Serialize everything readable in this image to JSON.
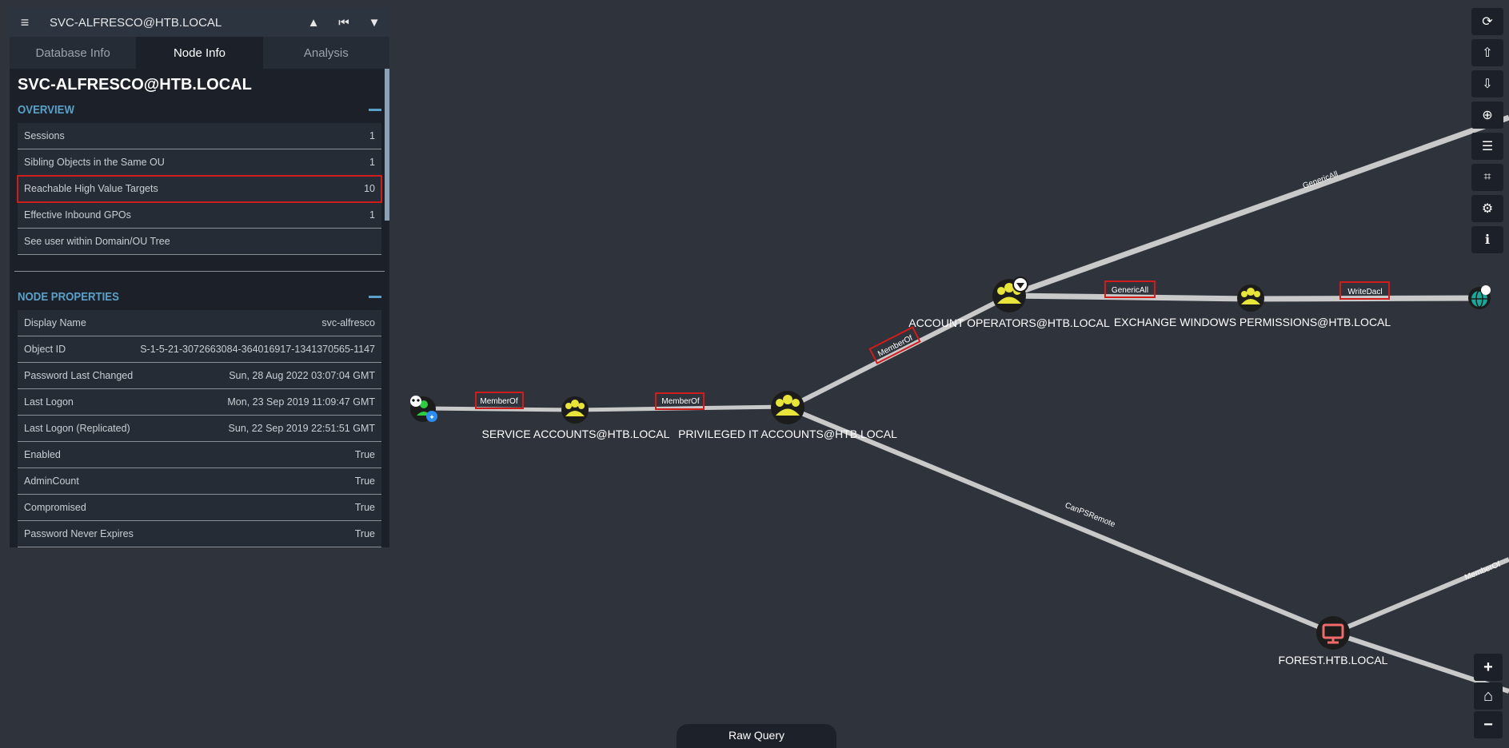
{
  "search": {
    "title": "SVC-ALFRESCO@HTB.LOCAL"
  },
  "tabs": [
    "Database Info",
    "Node Info",
    "Analysis"
  ],
  "node": {
    "title": "SVC-ALFRESCO@HTB.LOCAL"
  },
  "overview": {
    "title": "OVERVIEW",
    "rows": [
      {
        "label": "Sessions",
        "value": "1"
      },
      {
        "label": "Sibling Objects in the Same OU",
        "value": "1"
      },
      {
        "label": "Reachable High Value Targets",
        "value": "10"
      },
      {
        "label": "Effective Inbound GPOs",
        "value": "1"
      },
      {
        "label": "See user within Domain/OU Tree",
        "value": ""
      }
    ]
  },
  "properties": {
    "title": "NODE PROPERTIES",
    "rows": [
      {
        "label": "Display Name",
        "value": "svc-alfresco"
      },
      {
        "label": "Object ID",
        "value": "S-1-5-21-3072663084-364016917-1341370565-1147"
      },
      {
        "label": "Password Last Changed",
        "value": "Sun, 28 Aug 2022 03:07:04 GMT"
      },
      {
        "label": "Last Logon",
        "value": "Mon, 23 Sep 2019 11:09:47 GMT"
      },
      {
        "label": "Last Logon (Replicated)",
        "value": "Sun, 22 Sep 2019 22:51:51 GMT"
      },
      {
        "label": "Enabled",
        "value": "True"
      },
      {
        "label": "AdminCount",
        "value": "True"
      },
      {
        "label": "Compromised",
        "value": "True"
      },
      {
        "label": "Password Never Expires",
        "value": "True"
      }
    ]
  },
  "graph": {
    "nodes": {
      "service_accounts": "SERVICE ACCOUNTS@HTB.LOCAL",
      "privileged_it": "PRIVILEGED IT ACCOUNTS@HTB.LOCAL",
      "account_operators": "ACCOUNT OPERATORS@HTB.LOCAL",
      "exchange_windows": "EXCHANGE WINDOWS PERMISSIONS@HTB.LOCAL",
      "forest": "FOREST.HTB.LOCAL"
    },
    "edges": {
      "memberof": "MemberOf",
      "genericall": "GenericAll",
      "writedacl": "WriteDacl",
      "canpsremote": "CanPSRemote"
    }
  },
  "raw_query": "Raw Query",
  "toolbar_icons": [
    "refresh-icon",
    "upload-icon",
    "download-icon",
    "up-circle-icon",
    "list-icon",
    "chart-icon",
    "gears-icon",
    "info-icon"
  ],
  "colors": {
    "highlight": "#d11c1c",
    "group_node": "#e8e43a",
    "user_node": "#2ecc40",
    "computer_node": "#ef6a6a",
    "domain_node": "#1aa89a"
  }
}
